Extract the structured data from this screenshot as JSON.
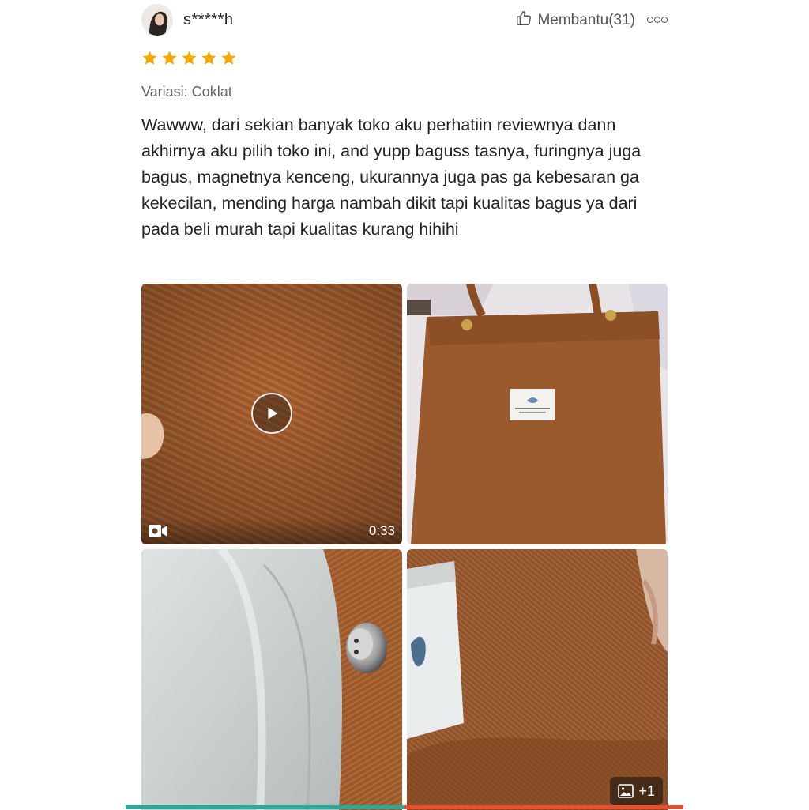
{
  "review": {
    "username": "s*****h",
    "helpful_label": "Membantu(31)",
    "rating": 5,
    "star_color": "#f6a700",
    "variation": "Variasi: Coklat",
    "text": "Wawww, dari sekian banyak toko aku perhatiin reviewnya dann akhirnya aku pilih toko ini, and yupp baguss tasnya, furingnya juga bagus, magnetnya kenceng, ukurannya juga pas ga kebesaran ga kekecilan, mending harga nambah dikit tapi kualitas bagus ya dari pada beli murah tapi kualitas kurang hihihi"
  },
  "media": {
    "video_duration": "0:33",
    "more_count": "+1"
  },
  "icons": [
    "avatar",
    "thumbs-up-icon",
    "more-options-icon",
    "star-icon",
    "play-icon",
    "video-camera-icon",
    "image-icon"
  ],
  "colors": {
    "accent_teal": "#26aa99",
    "accent_orange": "#ee4d2d"
  }
}
